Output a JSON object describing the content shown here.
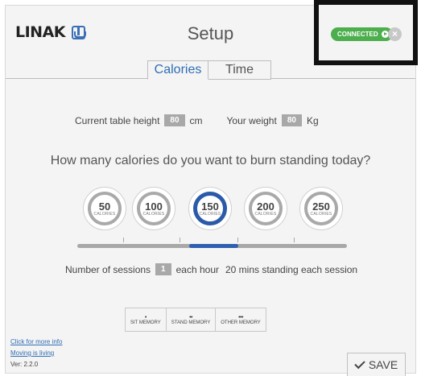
{
  "header": {
    "brand": "LINAK",
    "title": "Setup"
  },
  "status": {
    "connected_label": "CONNECTED",
    "close_glyph": "×"
  },
  "tabs": [
    {
      "label": "Calories",
      "active": true
    },
    {
      "label": "Time",
      "active": false
    }
  ],
  "settings": {
    "table_height_label": "Current table height",
    "table_height_value": "80",
    "table_height_unit": "cm",
    "weight_label": "Your weight",
    "weight_value": "80",
    "weight_unit": "Kg"
  },
  "question": "How many calories do you want to burn standing today?",
  "calorie_options": [
    {
      "value": "50",
      "unit": "CALORIES"
    },
    {
      "value": "100",
      "unit": "CALORIES"
    },
    {
      "value": "150",
      "unit": "CALORIES",
      "selected": true
    },
    {
      "value": "200",
      "unit": "CALORIES"
    },
    {
      "value": "250",
      "unit": "CALORIES"
    }
  ],
  "sessions": {
    "label": "Number of sessions",
    "value": "1",
    "suffix": "each hour",
    "detail": "20 mins standing each session"
  },
  "memory": [
    {
      "dots": "•",
      "label": "SIT MEMORY"
    },
    {
      "dots": "••",
      "label": "STAND MEMORY"
    },
    {
      "dots": "•••",
      "label": "OTHER MEMORY"
    }
  ],
  "footer": {
    "more_info": "Click for more info",
    "tagline": "Moving is living",
    "version": "Ver: 2.2.0",
    "save_label": "SAVE"
  },
  "colors": {
    "accent_blue": "#2e6db4",
    "connected_green": "#4cae4c",
    "slider_gray": "#a8a8a8"
  }
}
